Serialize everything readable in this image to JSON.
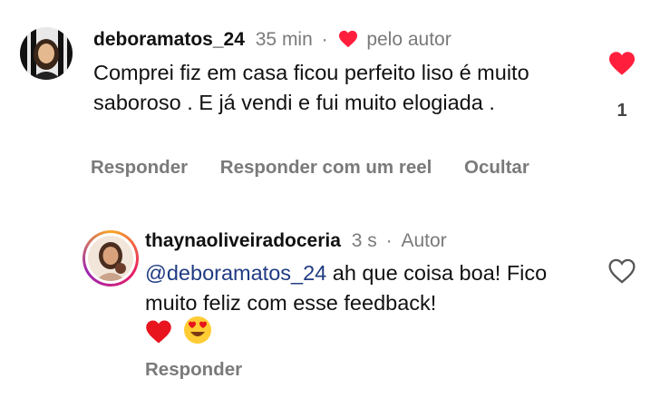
{
  "comments": [
    {
      "username": "deboramatos_24",
      "time": "35 min",
      "separator": "·",
      "author_like_label": "pelo autor",
      "text": "Comprei fiz em casa ficou perfeito liso é muito saboroso . E já vendi e fui muito elogiada .",
      "like_count": "1",
      "liked": true,
      "actions": [
        "Responder",
        "Responder com um reel",
        "Ocultar"
      ]
    },
    {
      "username": "thaynaoliveiradoceria",
      "time": "3 s",
      "separator": "·",
      "author_badge": "Autor",
      "mention": "@deboramatos_24",
      "text": " ah que coisa boa! Fico muito feliz com esse feedback!",
      "emojis": [
        "red-heart",
        "heart-eyes"
      ],
      "liked": false,
      "actions": [
        "Responder"
      ]
    }
  ],
  "colors": {
    "like_red": "#ff1f3d",
    "muted": "#7a7a7a",
    "mention": "#1f3b82"
  }
}
